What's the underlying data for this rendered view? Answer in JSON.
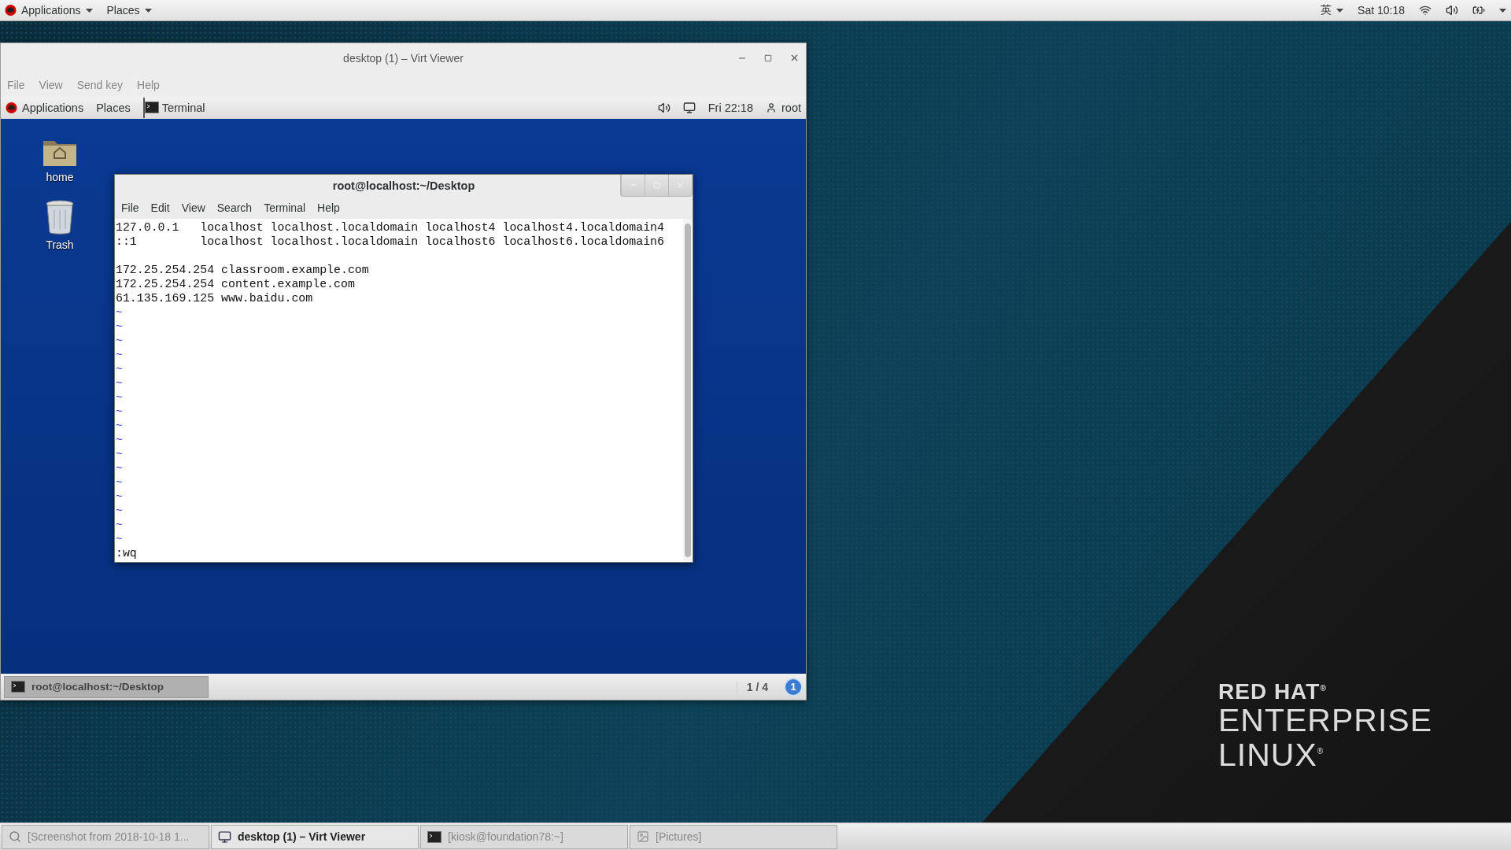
{
  "top_bar": {
    "menus": [
      {
        "label": "Applications"
      },
      {
        "label": "Places"
      }
    ],
    "input_method": "英",
    "clock": "Sat 10:18"
  },
  "viewer": {
    "title": "desktop (1) – Virt Viewer",
    "menu": [
      "File",
      "View",
      "Send key",
      "Help"
    ],
    "guest": {
      "top_bar": {
        "applications": "Applications",
        "places": "Places",
        "task": "Terminal",
        "clock": "Fri 22:18",
        "user": "root"
      },
      "desktop_icons": [
        {
          "label": "home",
          "kind": "folder"
        },
        {
          "label": "Trash",
          "kind": "trash"
        }
      ],
      "terminal": {
        "title": "root@localhost:~/Desktop",
        "menu": [
          "File",
          "Edit",
          "View",
          "Search",
          "Terminal",
          "Help"
        ],
        "lines": [
          {
            "kind": "text",
            "text": "127.0.0.1   localhost localhost.localdomain localhost4 localhost4.localdomain4"
          },
          {
            "kind": "text",
            "text": "::1         localhost localhost.localdomain localhost6 localhost6.localdomain6"
          },
          {
            "kind": "blank"
          },
          {
            "kind": "text",
            "text": "172.25.254.254 classroom.example.com"
          },
          {
            "kind": "text",
            "text": "172.25.254.254 content.example.com"
          },
          {
            "kind": "text",
            "text": "61.135.169.125 www.baidu.com"
          },
          {
            "kind": "tilde",
            "text": "~"
          },
          {
            "kind": "tilde",
            "text": "~"
          },
          {
            "kind": "tilde",
            "text": "~"
          },
          {
            "kind": "tilde",
            "text": "~"
          },
          {
            "kind": "tilde",
            "text": "~"
          },
          {
            "kind": "tilde",
            "text": "~"
          },
          {
            "kind": "tilde",
            "text": "~"
          },
          {
            "kind": "tilde",
            "text": "~"
          },
          {
            "kind": "tilde",
            "text": "~"
          },
          {
            "kind": "tilde",
            "text": "~"
          },
          {
            "kind": "tilde",
            "text": "~"
          },
          {
            "kind": "tilde",
            "text": "~"
          },
          {
            "kind": "tilde",
            "text": "~"
          },
          {
            "kind": "tilde",
            "text": "~"
          },
          {
            "kind": "tilde",
            "text": "~"
          },
          {
            "kind": "tilde",
            "text": "~"
          },
          {
            "kind": "tilde",
            "text": "~"
          }
        ],
        "command": ":wq"
      },
      "taskbar": {
        "items": [
          {
            "label": "root@localhost:~/Desktop"
          }
        ],
        "workspace": "1 / 4",
        "notifications": "1"
      }
    }
  },
  "taskbar": {
    "items": [
      {
        "label": "[Screenshot from 2018-10-18 1...",
        "kind": "viewer",
        "selected": false
      },
      {
        "label": "desktop (1) – Virt Viewer",
        "kind": "monitor",
        "selected": true
      },
      {
        "label": "[kiosk@foundation78:~]",
        "kind": "terminal",
        "selected": false
      },
      {
        "label": "[Pictures]",
        "kind": "pictures",
        "selected": false
      }
    ]
  },
  "branding": {
    "lines": [
      "RED HAT$^{®}$",
      "ENTERPRISE",
      "LINUX$^{®}$"
    ]
  }
}
